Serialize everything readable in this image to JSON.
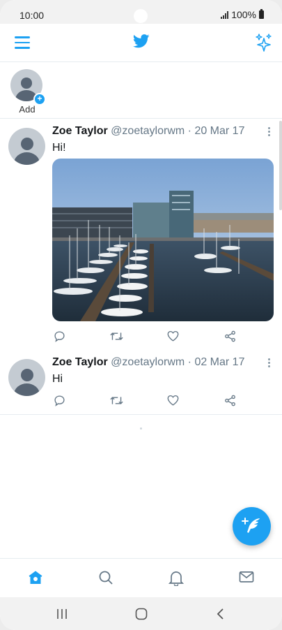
{
  "status_bar": {
    "time": "10:00",
    "battery": "100%"
  },
  "fleets": {
    "add_label": "Add"
  },
  "tweets": [
    {
      "name": "Zoe Taylor",
      "handle": "@zoetaylorwm",
      "separator": " · ",
      "date": "20 Mar 17",
      "text": "Hi!",
      "has_media": true
    },
    {
      "name": "Zoe Taylor",
      "handle": "@zoetaylorwm",
      "separator": " · ",
      "date": "02 Mar 17",
      "text": "Hi",
      "has_media": false
    }
  ],
  "colors": {
    "accent": "#1da1f2",
    "icon_gray": "#657786",
    "divider": "#e6ecf0"
  },
  "icons": {
    "top": [
      "menu-icon",
      "twitter-bird-icon",
      "sparkle-icon"
    ],
    "actions": [
      "reply-icon",
      "retweet-icon",
      "like-icon",
      "share-icon"
    ],
    "bottom_nav": [
      "home-icon",
      "search-icon",
      "bell-icon",
      "mail-icon"
    ],
    "system": [
      "recent-apps-icon",
      "home-button-icon",
      "back-icon"
    ]
  }
}
